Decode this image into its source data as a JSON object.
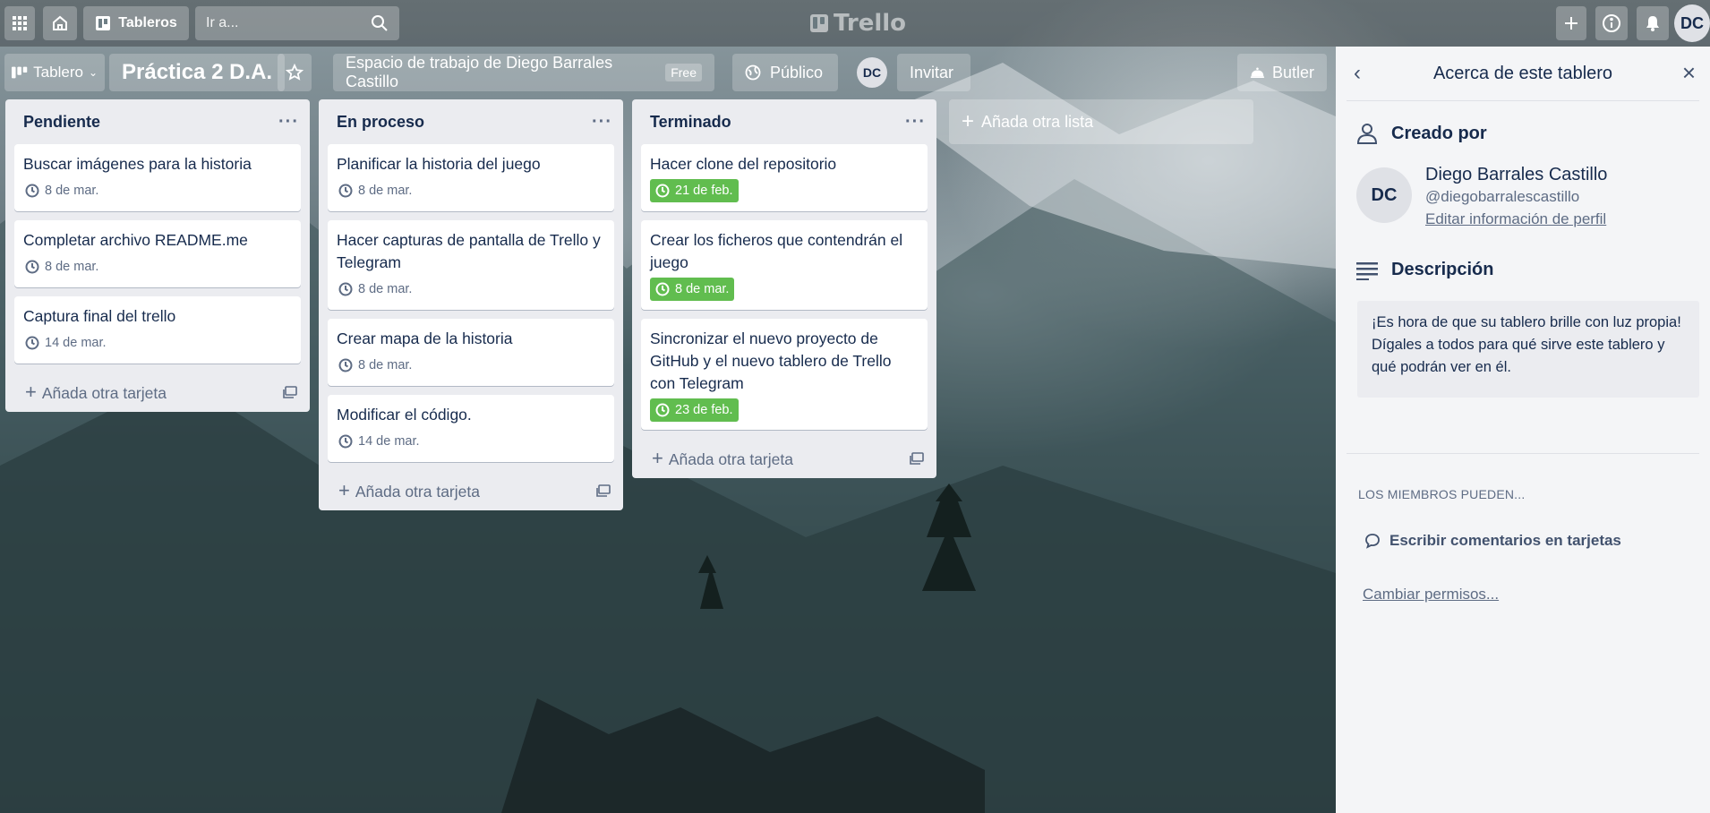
{
  "topbar": {
    "boards_label": "Tableros",
    "search_placeholder": "Ir a...",
    "logo_text": "Trello",
    "user_initials": "DC"
  },
  "board_header": {
    "view_label": "Tablero",
    "title": "Práctica 2 D.A.",
    "workspace": "Espacio de trabajo de Diego Barrales Castillo",
    "workspace_badge": "Free",
    "visibility": "Público",
    "member_initials": "DC",
    "invite_label": "Invitar",
    "butler_label": "Butler"
  },
  "lists": [
    {
      "title": "Pendiente",
      "cards": [
        {
          "title": "Buscar imágenes para la historia",
          "date": "8 de mar.",
          "done": false
        },
        {
          "title": "Completar archivo README.me",
          "date": "8 de mar.",
          "done": false
        },
        {
          "title": "Captura final del trello",
          "date": "14 de mar.",
          "done": false
        }
      ],
      "add_card_label": "Añada otra tarjeta"
    },
    {
      "title": "En proceso",
      "cards": [
        {
          "title": "Planificar la historia del juego",
          "date": "8 de mar.",
          "done": false
        },
        {
          "title": "Hacer capturas de pantalla de Trello y Telegram",
          "date": "8 de mar.",
          "done": false
        },
        {
          "title": "Crear mapa de la historia",
          "date": "8 de mar.",
          "done": false
        },
        {
          "title": "Modificar el código.",
          "date": "14 de mar.",
          "done": false
        }
      ],
      "add_card_label": "Añada otra tarjeta"
    },
    {
      "title": "Terminado",
      "cards": [
        {
          "title": "Hacer clone del repositorio",
          "date": "21 de feb.",
          "done": true
        },
        {
          "title": "Crear los ficheros que contendrán el juego",
          "date": "8 de mar.",
          "done": true
        },
        {
          "title": "Sincronizar el nuevo proyecto de GitHub y el nuevo tablero de Trello con Telegram",
          "date": "23 de feb.",
          "done": true
        }
      ],
      "add_card_label": "Añada otra tarjeta"
    }
  ],
  "add_list_label": "Añada otra lista",
  "panel": {
    "title": "Acerca de este tablero",
    "created_by_label": "Creado por",
    "creator_initials": "DC",
    "creator_name": "Diego Barrales Castillo",
    "creator_username": "@diegobarralescastillo",
    "edit_profile_link": "Editar información de perfil",
    "description_label": "Descripción",
    "description_text": "¡Es hora de que su tablero brille con luz propia! Dígales a todos para qué sirve este tablero y qué podrán ver en él.",
    "members_can_label": "LOS MIEMBROS PUEDEN...",
    "permission": "Escribir comentarios en tarjetas",
    "change_permissions_link": "Cambiar permisos..."
  },
  "colors": {
    "done_badge": "#61bd4f",
    "list_bg": "#ebecf0",
    "panel_bg": "#f4f5f7"
  }
}
